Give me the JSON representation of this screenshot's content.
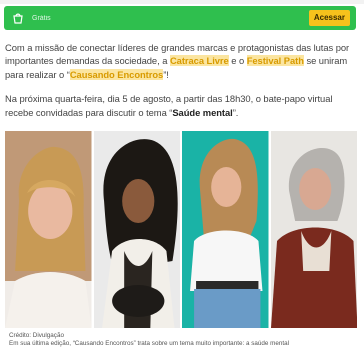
{
  "top_fragment": "...",
  "promo": {
    "label": "Grátis",
    "action_label": "Acessar",
    "icon": "shopping-bag-icon"
  },
  "article": {
    "p1": {
      "before": "Com a missão de conectar líderes de grandes marcas e protagonistas das lutas por importantes demandas da sociedade, a ",
      "link1": "Catraca Livre",
      "mid": " e o ",
      "link2": "Festival Path",
      "after1": " se uniram para realizar o “",
      "link3": "Causando Encontros",
      "after2": "”!"
    },
    "p2": {
      "before": "Na próxima quarta-feira, dia 5 de agosto, a partir das 18h30, o bate-papo virtual recebe convidadas para discutir o tema “",
      "emphasis": "Saúde mental",
      "after": "”."
    }
  },
  "photos": [
    {
      "name": "panelist-1-blonde-woman"
    },
    {
      "name": "panelist-2-curly-hair-woman"
    },
    {
      "name": "panelist-3-woman-teal-background"
    },
    {
      "name": "panelist-4-gray-hair-woman"
    }
  ],
  "caption": {
    "credit": "Crédito: Divulgação",
    "text": "Em sua última edição, “Causando Encontros” trata sobre um tema muito importante: a saúde mental"
  },
  "colors": {
    "promo_bg": "#2fbf4e",
    "action_bg": "#f6c21c",
    "link_fg": "#d89b00",
    "link_bg": "#fbe5a0"
  }
}
